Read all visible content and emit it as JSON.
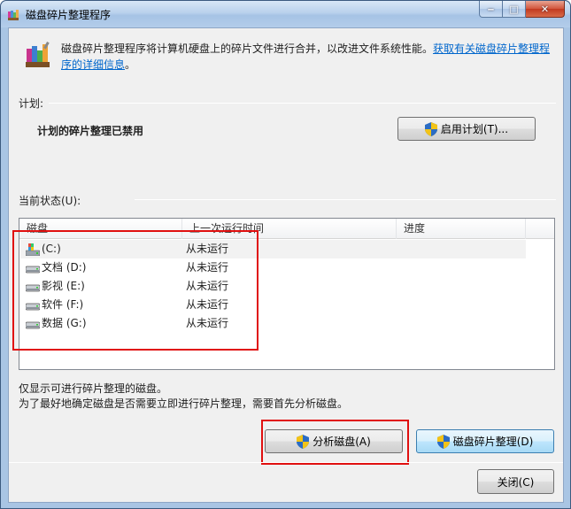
{
  "window": {
    "title": "磁盘碎片整理程序",
    "caption": {
      "minimize": "‒",
      "maximize": "□",
      "close": "✕"
    }
  },
  "intro": {
    "text": "磁盘碎片整理程序将计算机硬盘上的碎片文件进行合并，以改进文件系统性能。",
    "link": "获取有关磁盘碎片整理程序的详细信息",
    "suffix": "。"
  },
  "schedule": {
    "label": "计划:",
    "status": "计划的碎片整理已禁用",
    "button": "启用计划(T)..."
  },
  "current_status": {
    "label": "当前状态(U):",
    "columns": [
      "磁盘",
      "上一次运行时间",
      "进度"
    ],
    "rows": [
      {
        "disk": "(C:)",
        "last_run": "从未运行",
        "progress": "",
        "icon": "system-drive-icon"
      },
      {
        "disk": "文档 (D:)",
        "last_run": "从未运行",
        "progress": "",
        "icon": "drive-icon"
      },
      {
        "disk": "影视 (E:)",
        "last_run": "从未运行",
        "progress": "",
        "icon": "drive-icon"
      },
      {
        "disk": "软件 (F:)",
        "last_run": "从未运行",
        "progress": "",
        "icon": "drive-icon"
      },
      {
        "disk": "数据 (G:)",
        "last_run": "从未运行",
        "progress": "",
        "icon": "drive-icon"
      }
    ]
  },
  "notes": {
    "line1": "仅显示可进行碎片整理的磁盘。",
    "line2": "为了最好地确定磁盘是否需要立即进行碎片整理，需要首先分析磁盘。"
  },
  "buttons": {
    "analyze": "分析磁盘(A)",
    "defragment": "磁盘碎片整理(D)",
    "close": "关闭(C)"
  },
  "colors": {
    "link": "#0066cc",
    "highlight_box": "#e01010"
  }
}
